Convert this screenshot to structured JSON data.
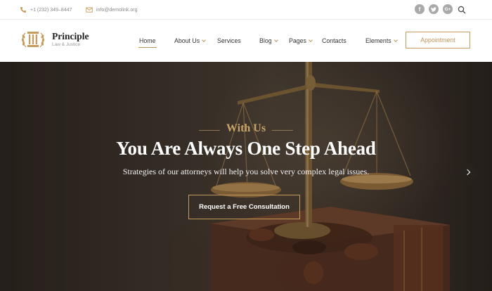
{
  "topbar": {
    "phone": "+1 (232) 349–8447",
    "email": "info@demolink.org",
    "social": [
      {
        "icon": "facebook-icon",
        "glyph": "f"
      },
      {
        "icon": "twitter-icon",
        "glyph": "t"
      },
      {
        "icon": "google-plus-icon",
        "glyph": "G+"
      }
    ],
    "search_icon": "search-icon"
  },
  "brand": {
    "title": "Principle",
    "subtitle": "Law & Justice",
    "logo_icon": "pillar-laurel-icon"
  },
  "nav": {
    "items": [
      {
        "label": "Home",
        "active": true,
        "dropdown": false
      },
      {
        "label": "About Us",
        "active": false,
        "dropdown": true
      },
      {
        "label": "Services",
        "active": false,
        "dropdown": false
      },
      {
        "label": "Blog",
        "active": false,
        "dropdown": true
      },
      {
        "label": "Pages",
        "active": false,
        "dropdown": true
      },
      {
        "label": "Contacts",
        "active": false,
        "dropdown": false
      },
      {
        "label": "Elements",
        "active": false,
        "dropdown": true
      }
    ],
    "appointment_label": "Appointment"
  },
  "hero": {
    "eyebrow": "With Us",
    "title": "You Are Always One Step Ahead",
    "subtitle": "Strategies of our attorneys will help you solve very complex legal issues.",
    "cta_label": "Request a Free Consultation",
    "next_icon": "chevron-right-icon"
  },
  "colors": {
    "accent": "#c69c5d",
    "text_dark": "#222222",
    "muted": "#8a8a8a"
  }
}
